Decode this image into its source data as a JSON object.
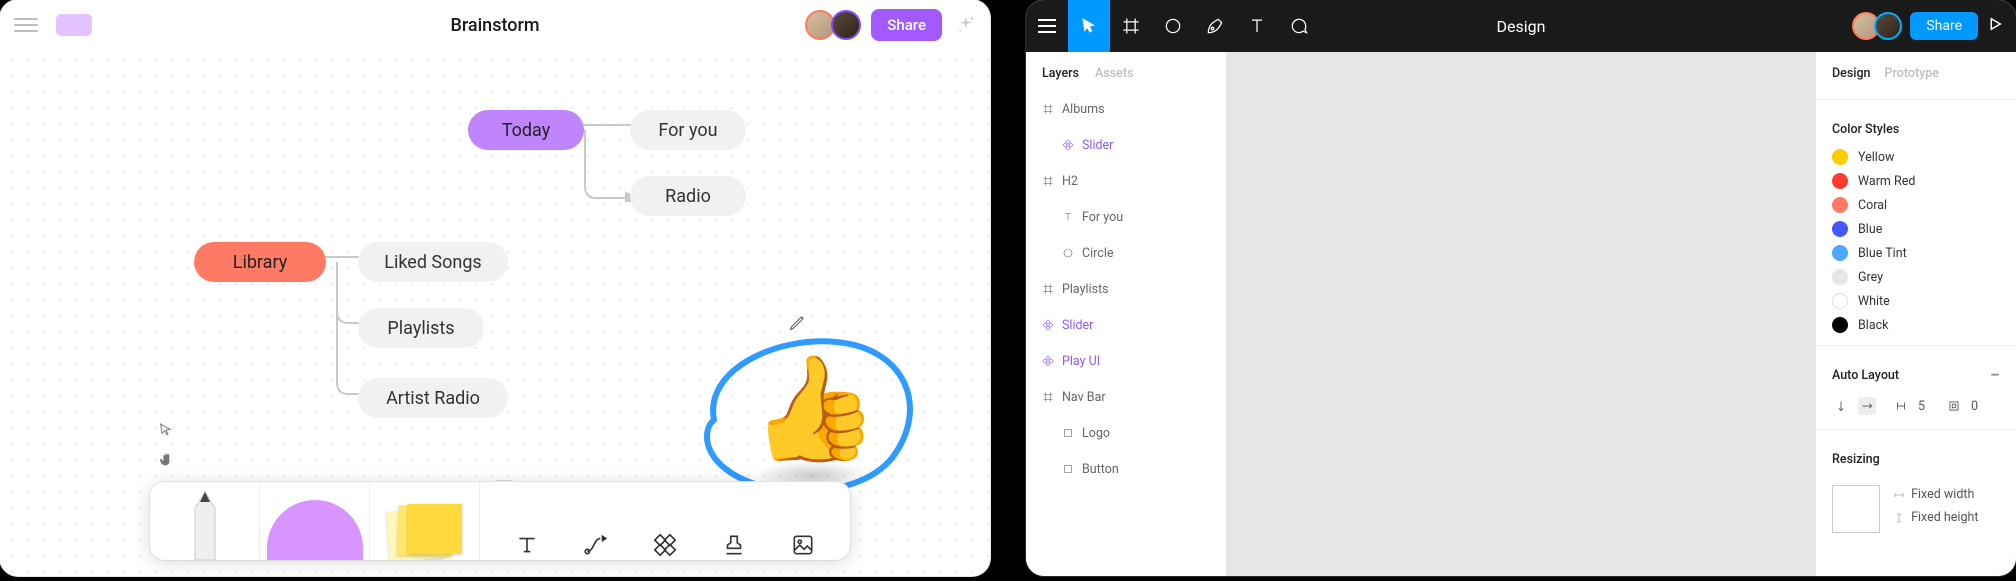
{
  "left_window": {
    "title": "Brainstorm",
    "share_label": "Share",
    "nodes": {
      "today": "Today",
      "for_you": "For you",
      "radio": "Radio",
      "library": "Library",
      "liked_songs": "Liked Songs",
      "playlists": "Playlists",
      "artist_radio": "Artist Radio"
    },
    "toolbar_icons": [
      "text",
      "connector",
      "shapes",
      "stamp",
      "image"
    ]
  },
  "right_window": {
    "title": "Design",
    "share_label": "Share",
    "left_tabs": {
      "layers": "Layers",
      "assets": "Assets"
    },
    "layers": [
      {
        "label": "Albums",
        "icon": "frame",
        "depth": 0,
        "purple": false
      },
      {
        "label": "Slider",
        "icon": "component",
        "depth": 1,
        "purple": true
      },
      {
        "label": "H2",
        "icon": "frame",
        "depth": 0,
        "purple": false
      },
      {
        "label": "For you",
        "icon": "text",
        "depth": 1,
        "purple": false
      },
      {
        "label": "Circle",
        "icon": "circle",
        "depth": 1,
        "purple": false
      },
      {
        "label": "Playlists",
        "icon": "frame",
        "depth": 0,
        "purple": false
      },
      {
        "label": "Slider",
        "icon": "component",
        "depth": 0,
        "purple": true
      },
      {
        "label": "Play UI",
        "icon": "component",
        "depth": 0,
        "purple": true
      },
      {
        "label": "Nav Bar",
        "icon": "frame",
        "depth": 0,
        "purple": false
      },
      {
        "label": "Logo",
        "icon": "rect",
        "depth": 1,
        "purple": false
      },
      {
        "label": "Button",
        "icon": "rect",
        "depth": 1,
        "purple": false
      }
    ],
    "right_tabs": {
      "design": "Design",
      "prototype": "Prototype"
    },
    "color_styles_header": "Color Styles",
    "color_styles": [
      {
        "name": "Yellow",
        "hex": "#ffcc00"
      },
      {
        "name": "Warm Red",
        "hex": "#ff3b30"
      },
      {
        "name": "Coral",
        "hex": "#ff7a65"
      },
      {
        "name": "Blue",
        "hex": "#4558ff"
      },
      {
        "name": "Blue Tint",
        "hex": "#4aa8ff"
      },
      {
        "name": "Grey",
        "hex": "#e6e6e6"
      },
      {
        "name": "White",
        "hex": "#ffffff"
      },
      {
        "name": "Black",
        "hex": "#000000"
      }
    ],
    "auto_layout_header": "Auto Layout",
    "auto_layout": {
      "spacing": "5",
      "padding": "0"
    },
    "resizing_header": "Resizing",
    "resizing": {
      "width": "Fixed width",
      "height": "Fixed height"
    }
  }
}
